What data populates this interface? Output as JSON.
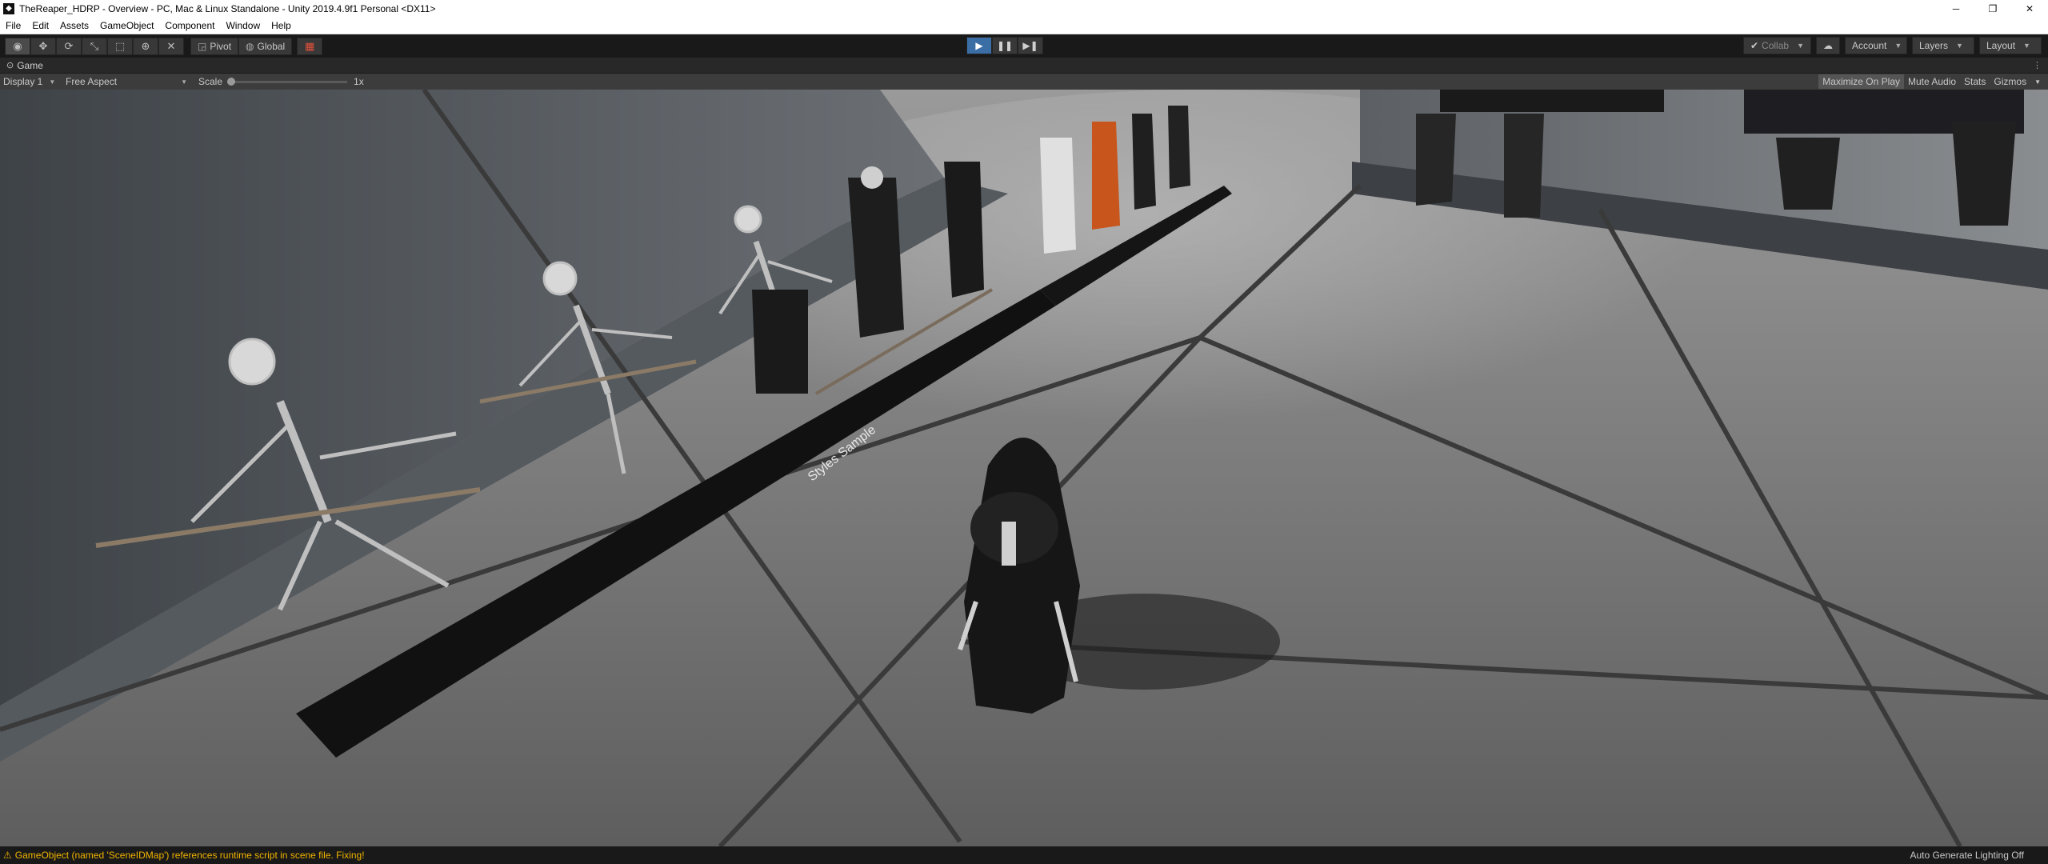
{
  "window": {
    "title": "TheReaper_HDRP - Overview - PC, Mac & Linux Standalone - Unity 2019.4.9f1 Personal <DX11>",
    "minimize": "─",
    "maximize": "❐",
    "close": "✕"
  },
  "menu": [
    "File",
    "Edit",
    "Assets",
    "GameObject",
    "Component",
    "Window",
    "Help"
  ],
  "toolbar": {
    "pivot_label": "Pivot",
    "global_label": "Global",
    "collab_label": "Collab",
    "account_label": "Account",
    "layers_label": "Layers",
    "layout_label": "Layout"
  },
  "game_tab": {
    "label": "Game",
    "display": "Display 1",
    "aspect": "Free Aspect",
    "scale_label": "Scale",
    "scale_value": "1x",
    "maximize_on_play": "Maximize On Play",
    "mute_audio": "Mute Audio",
    "stats": "Stats",
    "gizmos": "Gizmos"
  },
  "scene": {
    "banner_text": "Styles Sample"
  },
  "status": {
    "message": "GameObject (named 'SceneIDMap') references runtime script in scene file. Fixing!",
    "lighting": "Auto Generate Lighting Off"
  },
  "icons": {
    "play": "play-icon",
    "pause": "pause-icon",
    "step": "step-icon",
    "warning": "warning-icon",
    "cloud": "cloud-icon"
  },
  "colors": {
    "play_active": "#3a6ea5",
    "warning": "#f0b400",
    "editor_bg": "#191919"
  }
}
